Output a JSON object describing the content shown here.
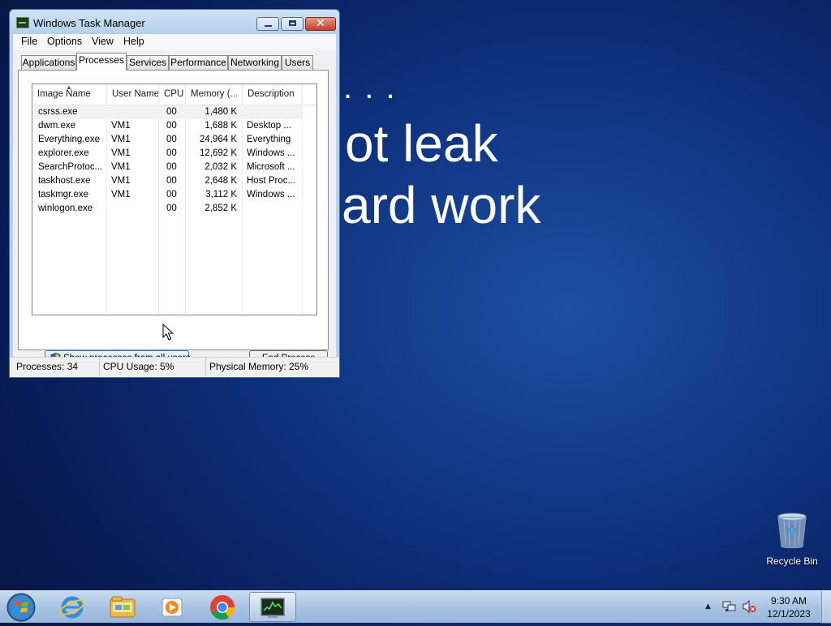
{
  "wallpaper": {
    "dots": ". . .",
    "line1": "ot leak",
    "line2": "ard work"
  },
  "window": {
    "title": "Windows Task Manager",
    "menu": [
      "File",
      "Options",
      "View",
      "Help"
    ],
    "tabs": [
      "Applications",
      "Processes",
      "Services",
      "Performance",
      "Networking",
      "Users"
    ],
    "active_tab": "Processes",
    "columns": [
      "Image Name",
      "User Name",
      "CPU",
      "Memory (...",
      "Description"
    ],
    "processes": [
      {
        "name": "csrss.exe",
        "user": "",
        "cpu": "00",
        "memory": "1,480 K",
        "description": ""
      },
      {
        "name": "dwm.exe",
        "user": "VM1",
        "cpu": "00",
        "memory": "1,688 K",
        "description": "Desktop ..."
      },
      {
        "name": "Everything.exe",
        "user": "VM1",
        "cpu": "00",
        "memory": "24,964 K",
        "description": "Everything"
      },
      {
        "name": "explorer.exe",
        "user": "VM1",
        "cpu": "00",
        "memory": "12,692 K",
        "description": "Windows ..."
      },
      {
        "name": "SearchProtoc...",
        "user": "VM1",
        "cpu": "00",
        "memory": "2,032 K",
        "description": "Microsoft ..."
      },
      {
        "name": "taskhost.exe",
        "user": "VM1",
        "cpu": "00",
        "memory": "2,648 K",
        "description": "Host Proc..."
      },
      {
        "name": "taskmgr.exe",
        "user": "VM1",
        "cpu": "00",
        "memory": "3,112 K",
        "description": "Windows ..."
      },
      {
        "name": "winlogon.exe",
        "user": "",
        "cpu": "00",
        "memory": "2,852 K",
        "description": ""
      }
    ],
    "show_all_button": "Show processes from all users",
    "end_process_button": "End Process",
    "status": {
      "processes": "Processes: 34",
      "cpu": "CPU Usage: 5%",
      "memory": "Physical Memory: 25%"
    }
  },
  "desktop": {
    "recycle_bin": "Recycle Bin"
  },
  "taskbar": {
    "pinned": [
      "start-orb",
      "internet-explorer-icon",
      "file-explorer-icon",
      "media-player-icon",
      "chrome-icon",
      "task-manager-icon"
    ],
    "active_app": "Windows Task Manager",
    "time": "9:30 AM",
    "date": "12/1/2023"
  },
  "colors": {
    "wallpaper_deep": "#071a52",
    "wallpaper_mid": "#1d4fa3",
    "window_frame": "#b7d2ee",
    "close_button": "#c1402a"
  }
}
